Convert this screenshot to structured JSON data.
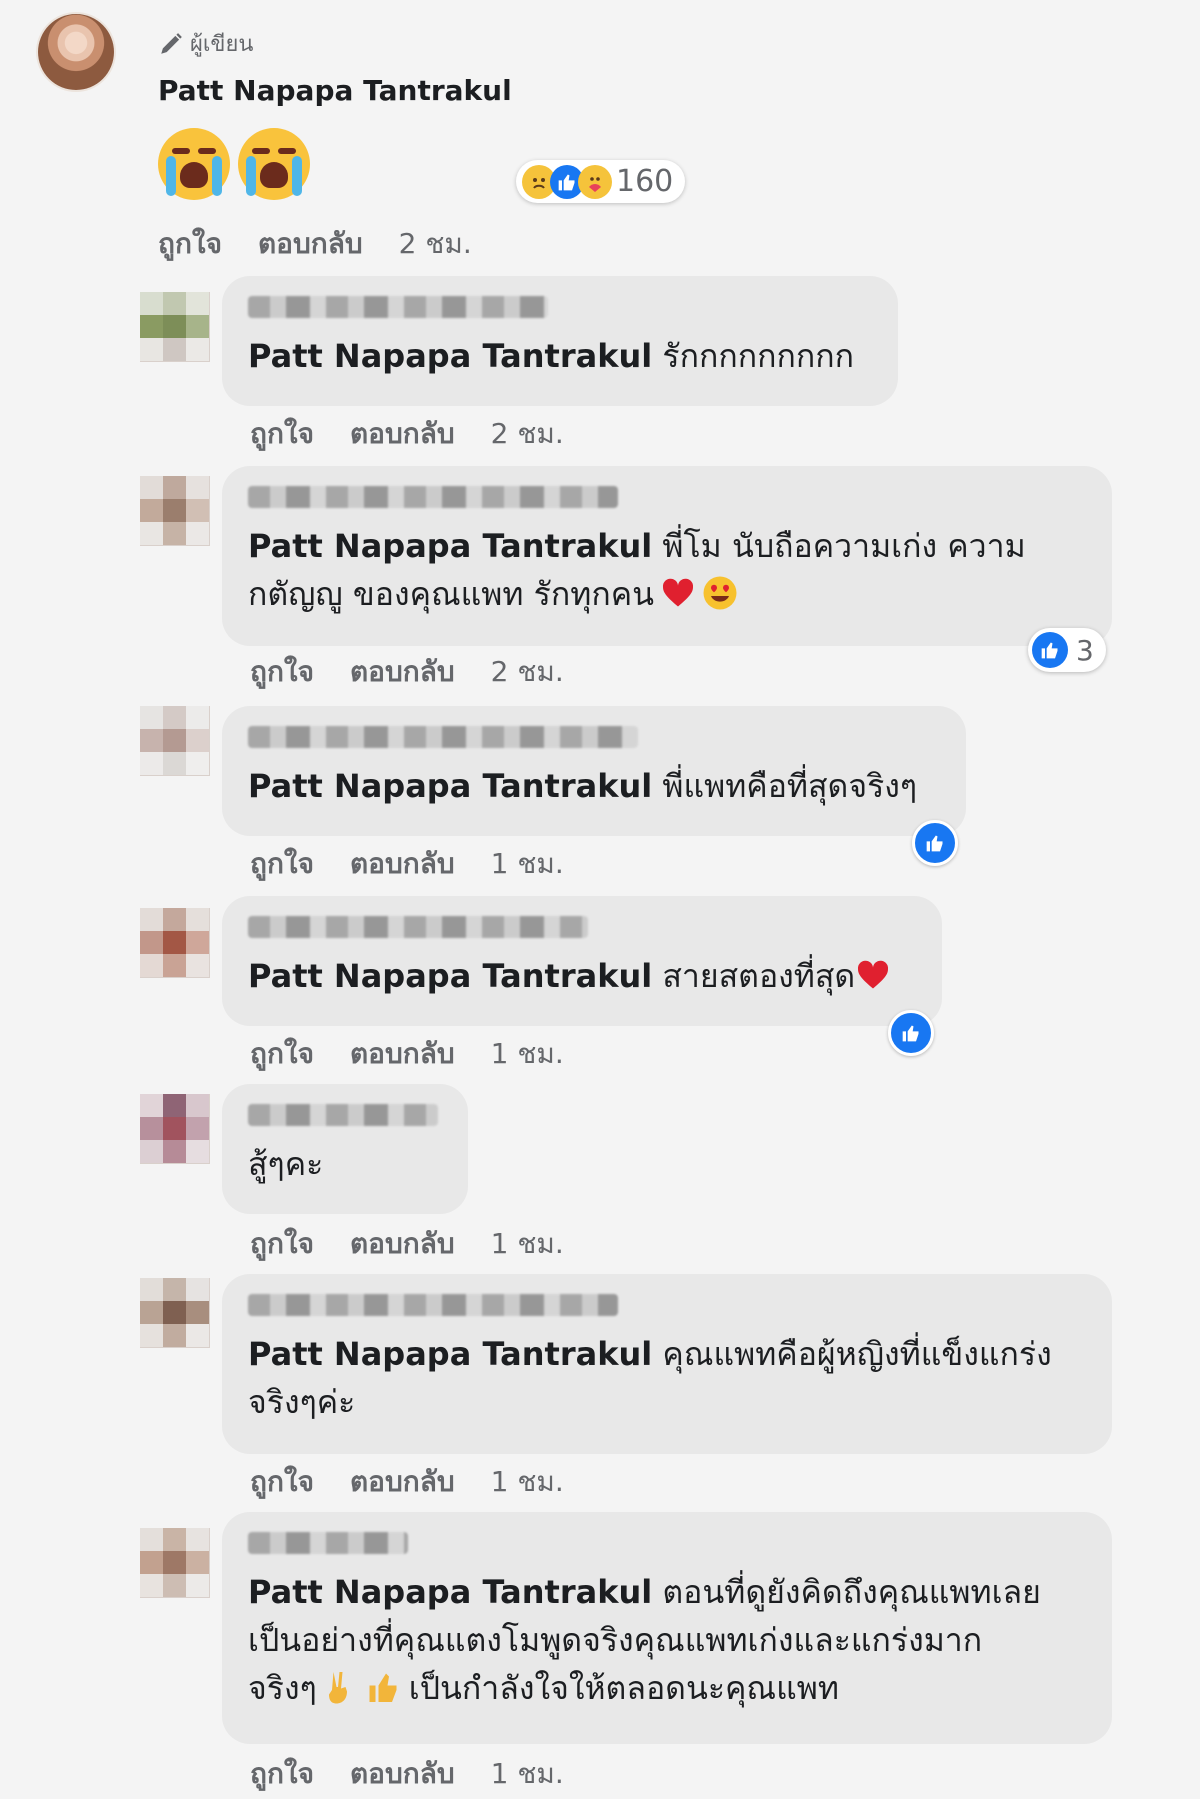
{
  "post": {
    "author_label": "ผู้เขียน",
    "name": "Patt Napapa Tantrakul",
    "reaction_count": "160",
    "actions": {
      "like": "ถูกใจ",
      "reply": "ตอบกลับ",
      "time": "2 ชม."
    }
  },
  "comments": [
    {
      "name": "Patt Napapa Tantrakul",
      "text": " รักกกกกกกกก",
      "time": "2 ชม."
    },
    {
      "name": "Patt Napapa Tantrakul",
      "text": " พี่โม นับถือความเก่ง ความ",
      "text2": "กตัญญู ของคุณแพท รักทุกคน",
      "time": "2 ชม.",
      "like_count": "3"
    },
    {
      "name": "Patt Napapa Tantrakul",
      "text": " พี่แพทคือที่สุดจริงๆ",
      "time": "1 ชม."
    },
    {
      "name": "Patt Napapa Tantrakul",
      "text": " สายสตองที่สุด",
      "time": "1 ชม."
    },
    {
      "text": "สู้ๆคะ",
      "time": "1 ชม."
    },
    {
      "name": "Patt Napapa Tantrakul",
      "text": " คุณแพทคือผู้หญิงที่แข็งแกร่ง",
      "text2": "จริงๆค่ะ",
      "time": "1 ชม."
    },
    {
      "name": "Patt Napapa Tantrakul",
      "text": " ตอนที่ดูยังคิดถึงคุณแพทเลย",
      "text2": "เป็นอย่างที่คุณแตงโมพูดจริงคุณแพทเก่งและแกร่งมาก",
      "text3a": "จริงๆ",
      "text3b": "เป็นกำลังใจให้ตลอดนะคุณแพท",
      "time": "1 ชม."
    }
  ],
  "labels": {
    "like": "ถูกใจ",
    "reply": "ตอบกลับ"
  },
  "colors": {
    "bubble": "#e8e8e8",
    "like_blue": "#1877f2",
    "meta_gray": "#65676b"
  }
}
